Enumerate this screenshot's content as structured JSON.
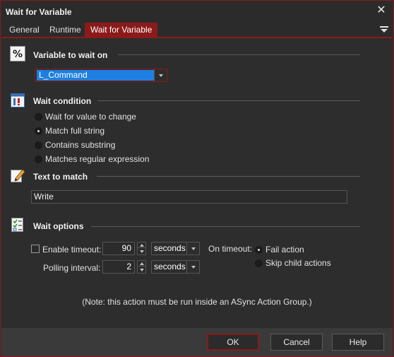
{
  "window": {
    "title": "Wait for Variable",
    "close_glyph": "✕"
  },
  "tabs": [
    {
      "label": "General"
    },
    {
      "label": "Runtime"
    },
    {
      "label": "Wait for Variable"
    }
  ],
  "sections": {
    "variable": {
      "title": "Variable to wait on",
      "icon": "percent-icon",
      "selected_variable": "L_Command"
    },
    "condition": {
      "title": "Wait condition",
      "icon": "condition-icon",
      "options": [
        {
          "label": "Wait for value to change",
          "selected": false
        },
        {
          "label": "Match full string",
          "selected": true
        },
        {
          "label": "Contains substring",
          "selected": false
        },
        {
          "label": "Matches regular expression",
          "selected": false
        }
      ]
    },
    "text_match": {
      "title": "Text to match",
      "icon": "pencil-icon",
      "value": "Write"
    },
    "options": {
      "title": "Wait options",
      "icon": "checklist-icon",
      "enable_timeout_label": "Enable timeout:",
      "enable_timeout_checked": false,
      "timeout_value": "90",
      "timeout_unit": "seconds",
      "polling_label": "Polling interval:",
      "polling_value": "2",
      "polling_unit": "seconds",
      "on_timeout_label": "On timeout:",
      "on_timeout_options": [
        {
          "label": "Fail action",
          "selected": true
        },
        {
          "label": "Skip child actions",
          "selected": false
        }
      ]
    }
  },
  "note": "(Note: this action must be run inside an ASync Action Group.)",
  "buttons": {
    "ok": "OK",
    "cancel": "Cancel",
    "help": "Help"
  },
  "colors": {
    "accent": "#8b1a1a",
    "background": "#2d2d2d",
    "selection": "#1e7fe0"
  }
}
